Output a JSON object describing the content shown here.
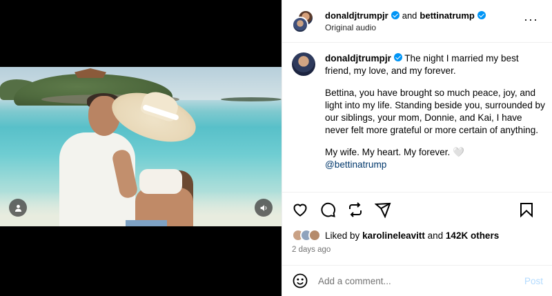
{
  "post": {
    "author": "donaldjtrumpjr",
    "conjunction": "and",
    "collaborator": "bettinatrump",
    "audio": "Original audio"
  },
  "caption": {
    "author": "donaldjtrumpjr",
    "line1": "The night I married my best friend, my love, and my forever.",
    "para2": "Bettina, you have brought so much peace, joy, and light into my life. Standing beside you, surrounded by our siblings, your mom, Donnie, and Kai, I have never felt more grateful or more certain of anything.",
    "para3": "My wife. My heart. My forever.",
    "para3_emoji": "🤍",
    "mention": "@bettinatrump"
  },
  "likes": {
    "prefix": "Liked by",
    "user": "karolineleavitt",
    "and": "and",
    "others": "142K others"
  },
  "time": "2 days ago",
  "comment": {
    "placeholder": "Add a comment...",
    "post_label": "Post"
  },
  "icons": {
    "more": "more-options-icon",
    "heart": "heart-icon",
    "comment": "comment-icon",
    "repost": "repost-icon",
    "share": "share-icon",
    "bookmark": "bookmark-icon",
    "emoji": "emoji-icon",
    "user_tag": "user-tag-icon",
    "audio": "audio-icon"
  },
  "colors": {
    "verified": "#0095f6",
    "mention": "#00376b",
    "post_disabled": "#b3dbff"
  }
}
